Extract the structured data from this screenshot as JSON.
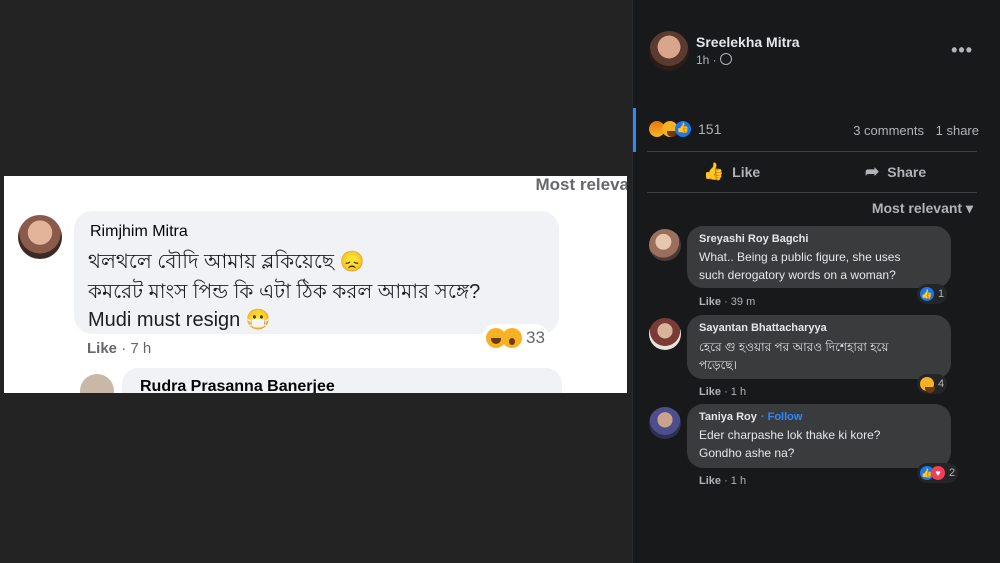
{
  "screenshot": {
    "sort_label": "Most releva",
    "comment": {
      "author": "Rimjhim Mitra",
      "line1": "থলথলে বৌদি আমায় ব্লকিয়েছে 😞",
      "line2": "কমরেট মাংস পিন্ড কি এটা ঠিক করল আমার সঙ্গে?",
      "line3": "Mudi must resign 😷",
      "reaction_count": "33",
      "like_label": "Like",
      "time": "· 7 h"
    },
    "reply_author": "Rudra Prasanna Banerjee"
  },
  "post": {
    "author": "Sreelekha Mitra",
    "time": "1h ·",
    "more_label": "•••",
    "reaction_count": "151",
    "comments_count": "3 comments",
    "shares_count": "1 share",
    "like_label": "Like",
    "share_label": "Share",
    "sort_label": "Most relevant ▾"
  },
  "comments": [
    {
      "author": "Sreyashi Roy Bagchi",
      "line1": "What.. Being a public figure, she uses",
      "line2": "such derogatory words on a woman?",
      "like_label": "Like",
      "time": "· 39 m",
      "reaction_count": "1"
    },
    {
      "author": "Sayantan Bhattacharyya",
      "line1": "হেরে গু হওয়ার পর আরও দিশেহারা হয়ে",
      "line2": "পড়েছে।",
      "like_label": "Like",
      "time": "· 1 h",
      "reaction_count": "4"
    },
    {
      "author": "Taniya Roy",
      "follow_label": "· Follow",
      "line1": "Eder charpashe lok thake ki kore?",
      "line2": "Gondho ashe na?",
      "like_label": "Like",
      "time": "· 1 h",
      "reaction_count": "2"
    }
  ],
  "colors": {
    "background": "#232323",
    "panel": "#18191a",
    "bubble": "#3a3b3c",
    "accent": "#2d88ff"
  }
}
